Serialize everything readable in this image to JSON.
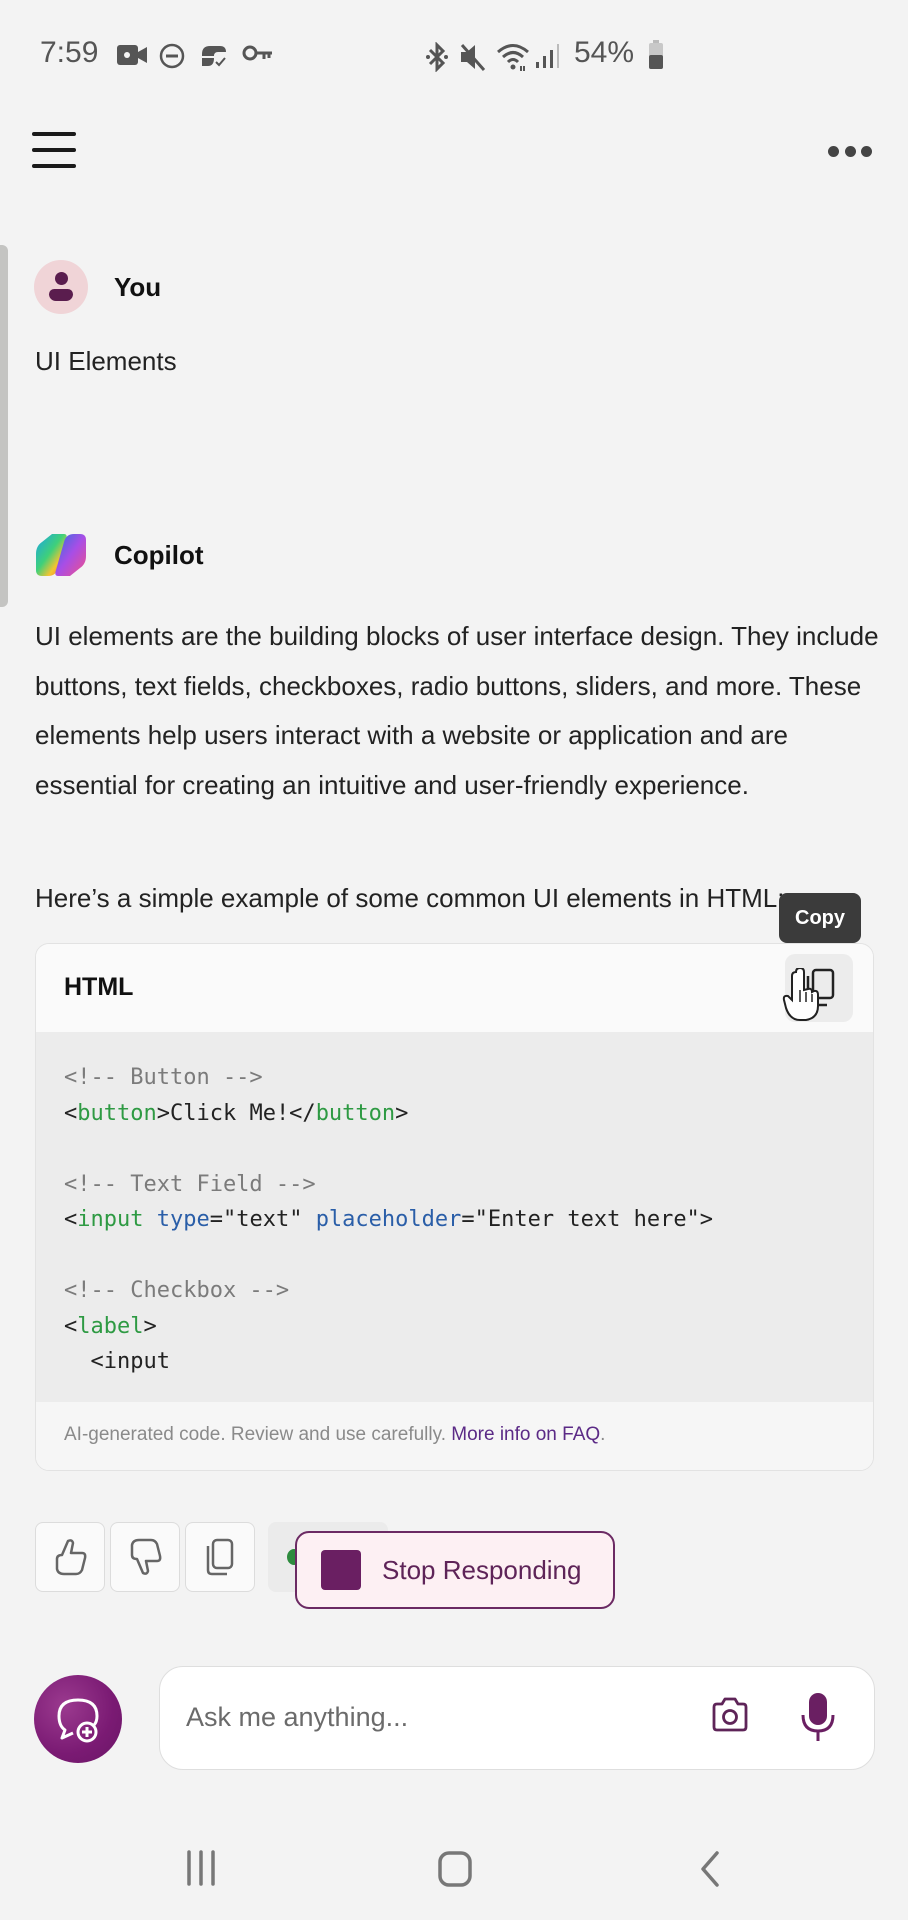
{
  "status_bar": {
    "time": "7:59",
    "left_icons": [
      "video-recording-icon",
      "do-not-disturb-icon",
      "vpn-link-icon",
      "key-icon"
    ],
    "right_icons": [
      "bluetooth-icon",
      "muted-icon",
      "wifi-icon",
      "signal-icon"
    ],
    "battery": "54%"
  },
  "header": {
    "menu_icon": "hamburger-menu-icon",
    "more_icon": "more-options-icon"
  },
  "conversation": {
    "user": {
      "name": "You",
      "message": "UI Elements"
    },
    "assistant": {
      "name": "Copilot",
      "paragraph_1": "UI elements are the building blocks of user interface design. They include buttons, text fields, checkboxes, radio buttons, sliders, and more. These elements help users interact with a website or application and are essential for creating an intuitive and user-friendly experience.",
      "paragraph_2": "Here’s a simple example of some common UI elements in HTML:",
      "code_block": {
        "language": "HTML",
        "copy_tooltip": "Copy",
        "lines": [
          [
            {
              "t": "<!-- Button -->",
              "c": "comment"
            }
          ],
          [
            {
              "t": "<",
              "c": "plain"
            },
            {
              "t": "button",
              "c": "tag"
            },
            {
              "t": ">Click Me!</",
              "c": "plain"
            },
            {
              "t": "button",
              "c": "tag"
            },
            {
              "t": ">",
              "c": "plain"
            }
          ],
          [],
          [
            {
              "t": "<!-- Text Field -->",
              "c": "comment"
            }
          ],
          [
            {
              "t": "<",
              "c": "plain"
            },
            {
              "t": "input",
              "c": "tag"
            },
            {
              "t": " ",
              "c": "plain"
            },
            {
              "t": "type",
              "c": "attr"
            },
            {
              "t": "=\"text\" ",
              "c": "plain"
            },
            {
              "t": "placeholder",
              "c": "attr"
            },
            {
              "t": "=\"Enter text here\">",
              "c": "plain"
            }
          ],
          [],
          [
            {
              "t": "<!-- Checkbox -->",
              "c": "comment"
            }
          ],
          [
            {
              "t": "<",
              "c": "plain"
            },
            {
              "t": "label",
              "c": "tag"
            },
            {
              "t": ">",
              "c": "plain"
            }
          ],
          [
            {
              "t": "  <input",
              "c": "plain"
            }
          ]
        ],
        "disclaimer": "AI-generated code. Review and use carefully. ",
        "faq_link": "More info on FAQ",
        "faq_suffix": "."
      }
    },
    "feedback": {
      "like_icon": "thumbs-up-icon",
      "dislike_icon": "thumbs-down-icon",
      "copy_icon": "copy-icon"
    },
    "stop_button": "Stop Responding"
  },
  "composer": {
    "placeholder": "Ask me anything...",
    "value": "",
    "new_topic_icon": "new-chat-icon",
    "camera_icon": "camera-icon",
    "mic_icon": "microphone-icon"
  },
  "nav_bar": {
    "recents": "recent-apps-icon",
    "home": "home-icon",
    "back": "back-icon"
  },
  "colors": {
    "accent": "#6a1f62",
    "background": "#f3f3f3",
    "code_tag": "#2e9a43",
    "code_attr": "#2a5ea8",
    "code_comment": "#7b7b7b"
  }
}
